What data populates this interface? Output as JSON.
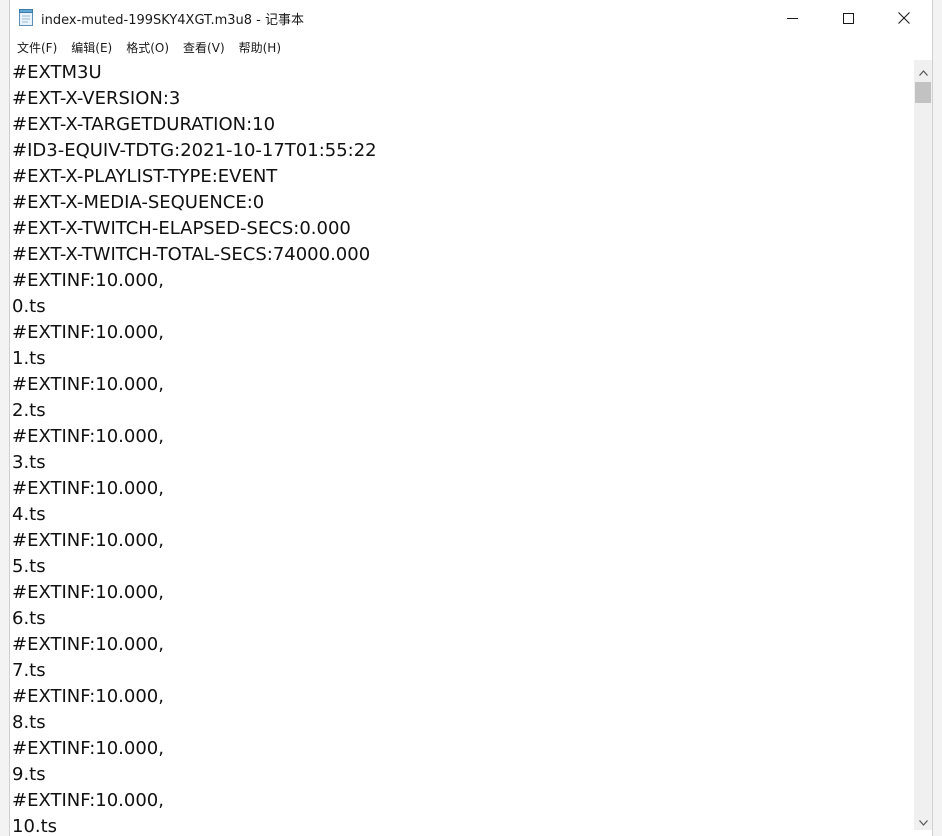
{
  "window": {
    "title": "index-muted-199SKY4XGT.m3u8 - 记事本"
  },
  "menu": {
    "items": [
      {
        "label": "文件(F)"
      },
      {
        "label": "编辑(E)"
      },
      {
        "label": "格式(O)"
      },
      {
        "label": "查看(V)"
      },
      {
        "label": "帮助(H)"
      }
    ]
  },
  "editor": {
    "lines": [
      "#EXTM3U",
      "#EXT-X-VERSION:3",
      "#EXT-X-TARGETDURATION:10",
      "#ID3-EQUIV-TDTG:2021-10-17T01:55:22",
      "#EXT-X-PLAYLIST-TYPE:EVENT",
      "#EXT-X-MEDIA-SEQUENCE:0",
      "#EXT-X-TWITCH-ELAPSED-SECS:0.000",
      "#EXT-X-TWITCH-TOTAL-SECS:74000.000",
      "#EXTINF:10.000,",
      "0.ts",
      "#EXTINF:10.000,",
      "1.ts",
      "#EXTINF:10.000,",
      "2.ts",
      "#EXTINF:10.000,",
      "3.ts",
      "#EXTINF:10.000,",
      "4.ts",
      "#EXTINF:10.000,",
      "5.ts",
      "#EXTINF:10.000,",
      "6.ts",
      "#EXTINF:10.000,",
      "7.ts",
      "#EXTINF:10.000,",
      "8.ts",
      "#EXTINF:10.000,",
      "9.ts",
      "#EXTINF:10.000,",
      "10.ts"
    ]
  },
  "icons": {
    "app": "notepad-icon",
    "minimize": "minimize-icon",
    "maximize": "maximize-icon",
    "close": "close-icon",
    "scroll_up": "chevron-up-icon",
    "scroll_down": "chevron-down-icon"
  },
  "colors": {
    "text": "#111111",
    "background": "#ffffff",
    "scroll_track": "#f0f0f0",
    "scroll_thumb": "#c2c2c2"
  }
}
